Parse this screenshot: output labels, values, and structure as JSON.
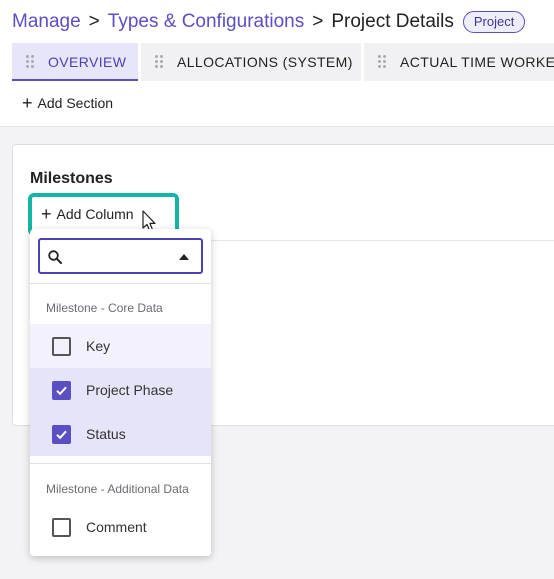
{
  "breadcrumb": {
    "items": [
      "Manage",
      "Types & Configurations"
    ],
    "separator": ">",
    "current": "Project Details",
    "badge": "Project"
  },
  "tabs": [
    {
      "label": "OVERVIEW",
      "active": true
    },
    {
      "label": "ALLOCATIONS (SYSTEM)",
      "active": false
    },
    {
      "label": "ACTUAL TIME WORKED",
      "active": false
    }
  ],
  "toolbar": {
    "add_section_label": "Add Section",
    "plus_glyph": "+"
  },
  "section": {
    "title": "Milestones",
    "add_column_label": "Add Column"
  },
  "dropdown": {
    "search": {
      "placeholder": "",
      "value": ""
    },
    "groups": [
      {
        "label": "Milestone - Core Data",
        "options": [
          {
            "label": "Key",
            "checked": false
          },
          {
            "label": "Project Phase",
            "checked": true
          },
          {
            "label": "Status",
            "checked": true
          }
        ]
      },
      {
        "label": "Milestone - Additional Data",
        "options": [
          {
            "label": "Comment",
            "checked": false
          }
        ]
      }
    ]
  },
  "colors": {
    "accent": "#5b4fc4",
    "highlight": "#12b5a6",
    "selected_bg": "#e6e4f8"
  },
  "icons": [
    "drag-handle-icon",
    "plus-icon",
    "search-icon",
    "caret-up-icon",
    "checkbox-icon",
    "mouse-pointer-icon"
  ]
}
